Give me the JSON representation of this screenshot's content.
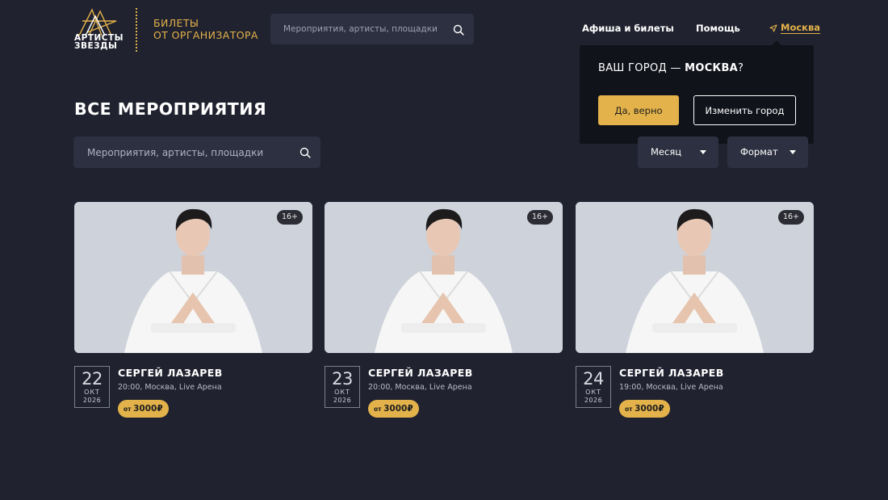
{
  "brand": {
    "logo_line1": "АРТИСТЫ",
    "logo_line2": "ЗВЕЗДЫ",
    "tagline_line1": "БИЛЕТЫ",
    "tagline_line2": "ОТ ОРГАНИЗАТОРА",
    "accent_color": "#e3b24a"
  },
  "header": {
    "search_placeholder": "Мероприятия, артисты, площадки",
    "nav": [
      {
        "label": "Афиша и билеты"
      },
      {
        "label": "Помощь"
      }
    ],
    "city": "Москва"
  },
  "city_popup": {
    "question_prefix": "ВАШ ГОРОД — ",
    "city": "МОСКВА",
    "question_suffix": "?",
    "confirm_label": "Да, верно",
    "change_label": "Изменить город"
  },
  "page": {
    "title": "ВСЕ МЕРОПРИЯТИЯ",
    "search_placeholder": "Мероприятия, артисты, площадки",
    "filters": [
      {
        "label": "Месяц"
      },
      {
        "label": "Формат"
      }
    ]
  },
  "events": [
    {
      "age": "16+",
      "day": "22",
      "month": "ОКТ",
      "year": "2026",
      "title": "СЕРГЕЙ ЛАЗАРЕВ",
      "meta": "20:00, Москва, Live Арена",
      "price_prefix": "от ",
      "price": "3000₽"
    },
    {
      "age": "16+",
      "day": "23",
      "month": "ОКТ",
      "year": "2026",
      "title": "СЕРГЕЙ ЛАЗАРЕВ",
      "meta": "20:00, Москва, Live Арена",
      "price_prefix": "от ",
      "price": "3000₽"
    },
    {
      "age": "16+",
      "day": "24",
      "month": "ОКТ",
      "year": "2026",
      "title": "СЕРГЕЙ ЛАЗАРЕВ",
      "meta": "19:00, Москва, Live Арена",
      "price_prefix": "от ",
      "price": "3000₽"
    }
  ]
}
